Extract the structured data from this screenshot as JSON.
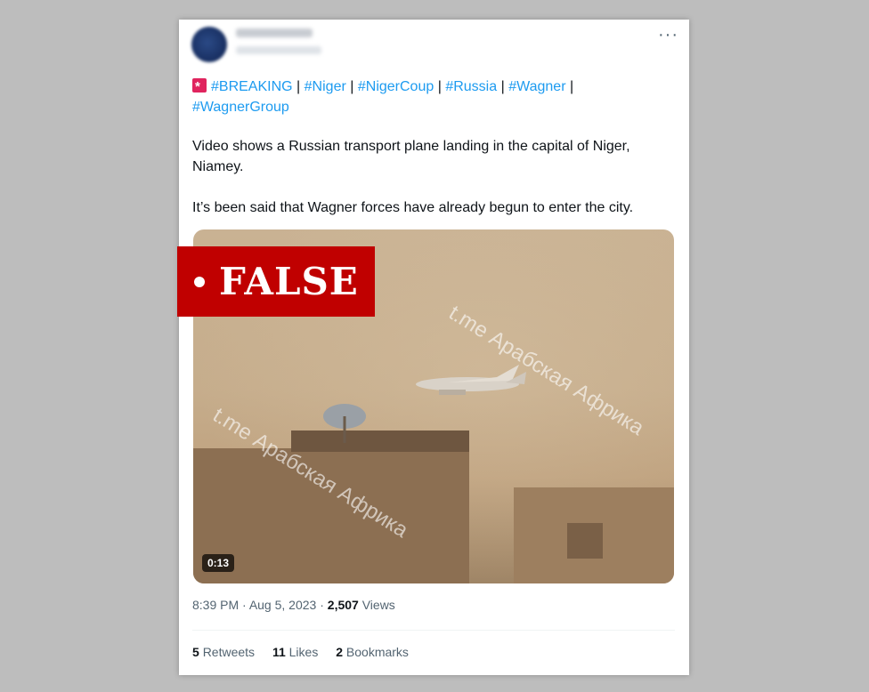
{
  "tweet": {
    "hashtags": [
      "#BREAKING",
      "#Niger",
      "#NigerCoup",
      "#Russia",
      "#Wagner",
      "#WagnerGroup"
    ],
    "separator": "|",
    "text_p1": "Video shows a Russian transport plane landing in the capital of Niger, Niamey.",
    "text_p2": "It’s been said that Wagner forces have already begun to enter the city.",
    "more_label": "···",
    "icons": {
      "siren": "rotating-light-icon",
      "more": "more-icon"
    }
  },
  "media": {
    "duration": "0:13",
    "watermark_1": "t.me Арабская Африка",
    "watermark_2": "t.me Арабская Африка"
  },
  "meta": {
    "time": "8:39 PM",
    "date": "Aug 5, 2023",
    "views_count": "2,507",
    "views_label": "Views"
  },
  "stats": {
    "retweets_count": "5",
    "retweets_label": "Retweets",
    "likes_count": "11",
    "likes_label": "Likes",
    "bookmarks_count": "2",
    "bookmarks_label": "Bookmarks"
  },
  "verdict": {
    "label": "FALSE",
    "color": "#c00000"
  },
  "colors": {
    "link": "#1d9bf0",
    "text": "#0f1419",
    "muted": "#536471",
    "background": "#bdbdbd"
  }
}
